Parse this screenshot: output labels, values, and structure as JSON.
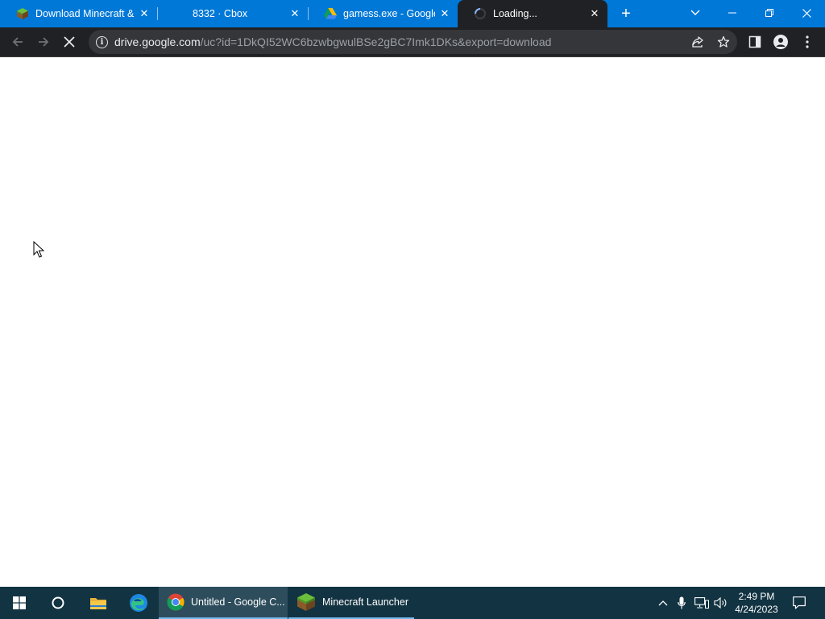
{
  "browser": {
    "tabs": [
      {
        "title": "Download Minecraft &",
        "favicon": "minecraft-grass-icon",
        "active": false
      },
      {
        "title": "8332 · Cbox",
        "favicon": "none",
        "active": false
      },
      {
        "title": "gamess.exe - Google D",
        "favicon": "google-drive-icon",
        "active": false
      },
      {
        "title": "Loading...",
        "favicon": "loading-spinner-icon",
        "active": true
      }
    ],
    "new_tab_label": "+",
    "omnibox": {
      "host": "drive.google.com",
      "path": "/uc?id=1DkQI52WC6bzwbgwulBSe2gBC7Imk1DKs&export=download"
    }
  },
  "taskbar": {
    "apps": [
      {
        "label": "Untitled - Google C...",
        "icon": "chrome-icon",
        "active": true
      },
      {
        "label": "Minecraft Launcher",
        "icon": "minecraft-grass-icon",
        "active": false
      }
    ],
    "clock": {
      "time": "2:49 PM",
      "date": "4/24/2023"
    }
  },
  "colors": {
    "tabstrip": "#0078d7",
    "toolbar": "#202124",
    "omnibox": "#35363a",
    "taskbar": "#123342"
  }
}
